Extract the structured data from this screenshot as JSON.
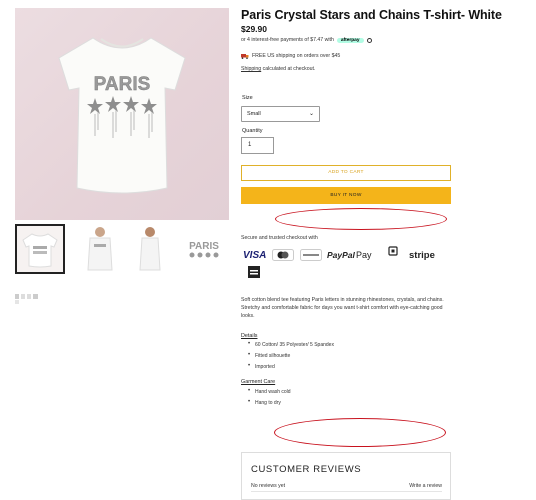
{
  "product": {
    "title": "Paris Crystal Stars and Chains T-shirt- White",
    "price": "$29.90",
    "installments_prefix": "or 4 interest-free payments of $7.47 with",
    "installments_brand": "afterpay",
    "shipping_notice": "FREE US shipping on orders over $45",
    "shipping_link": "Shipping",
    "shipping_suffix": "calculated at checkout.",
    "image_print_text": "PARIS"
  },
  "options": {
    "size_label": "Size",
    "size_value": "Small",
    "quantity_label": "Quantity",
    "quantity_value": "1"
  },
  "buttons": {
    "add_to_cart": "ADD TO CART",
    "buy_it_now": "BUY IT NOW"
  },
  "checkout": {
    "secure_text": "Secure and trusted checkout with",
    "methods": [
      "VISA",
      "mastercard",
      "DISCOVER",
      "PayPal",
      "Apple Pay",
      "Venmo",
      "stripe",
      "AMEX"
    ]
  },
  "description": {
    "text": "Soft cotton blend tee featuring Paris letters in stunning rhinestones, crystals, and chains.  Stretchy and comfortable fabric for days you want t-shirt comfort with eye-catching good looks.",
    "details_title": "Details",
    "details": [
      "60 Cotton/ 35 Polyester/ 5 Spandex",
      "Fitted silhouette",
      "Imported"
    ],
    "care_title": "Garment Care",
    "care": [
      "Hand wash cold",
      "Hang to dry"
    ]
  },
  "reviews": {
    "title": "CUSTOMER REVIEWS",
    "empty_text": "No reviews yet",
    "write_link": "Write a review"
  },
  "colors": {
    "accent": "#f4b41a",
    "annotation": "#c8121e",
    "afterpay": "#b2fce4"
  }
}
